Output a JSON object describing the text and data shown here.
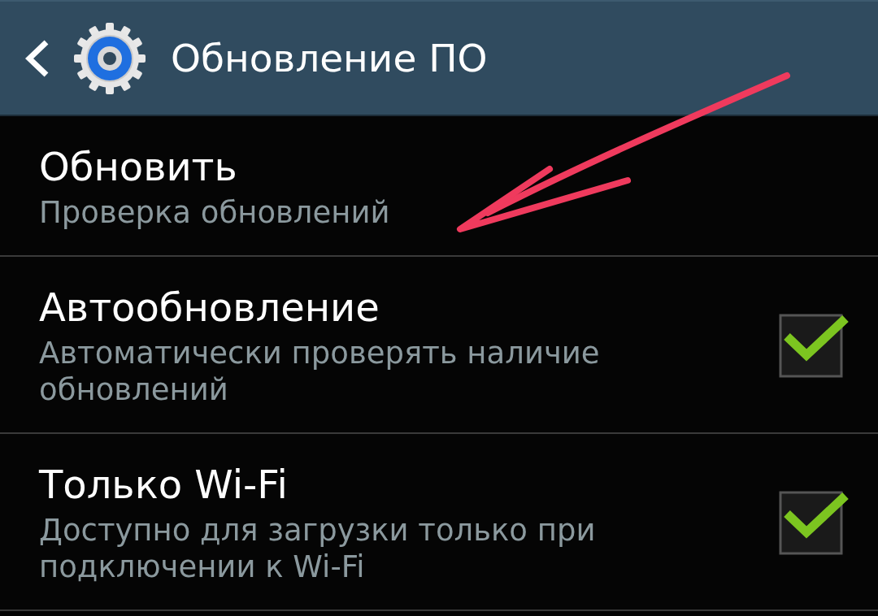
{
  "header": {
    "title": "Обновление ПО"
  },
  "items": [
    {
      "kind": "action",
      "title": "Обновить",
      "subtitle": "Проверка обновлений"
    },
    {
      "kind": "checkbox",
      "title": "Автообновление",
      "subtitle": "Автоматически проверять наличие обновлений",
      "checked": true
    },
    {
      "kind": "checkbox",
      "title": "Только Wi-Fi",
      "subtitle": "Доступно для загрузки только при подключении к Wi-Fi",
      "checked": true
    }
  ]
}
